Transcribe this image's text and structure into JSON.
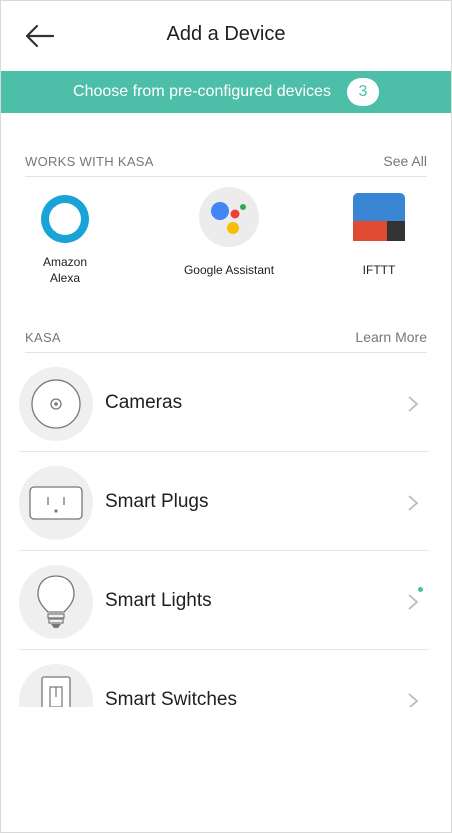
{
  "header": {
    "title": "Add a Device",
    "back_icon": "arrow-left-icon"
  },
  "banner": {
    "text": "Choose from pre-configured devices",
    "count": "3",
    "color": "#4dbfa8"
  },
  "works_with": {
    "title": "WORKS WITH KASA",
    "link": "See All",
    "partners": [
      {
        "label": "Amazon\nAlexa",
        "icon": "alexa-icon"
      },
      {
        "label": "Google Assistant",
        "icon": "google-assistant-icon"
      },
      {
        "label": "IFTTT",
        "icon": "ifttt-icon"
      }
    ]
  },
  "kasa": {
    "title": "KASA",
    "link": "Learn More",
    "devices": [
      {
        "label": "Cameras",
        "icon": "camera-icon"
      },
      {
        "label": "Smart Plugs",
        "icon": "plug-icon"
      },
      {
        "label": "Smart Lights",
        "icon": "bulb-icon"
      },
      {
        "label": "Smart Switches",
        "icon": "switch-icon"
      }
    ]
  }
}
